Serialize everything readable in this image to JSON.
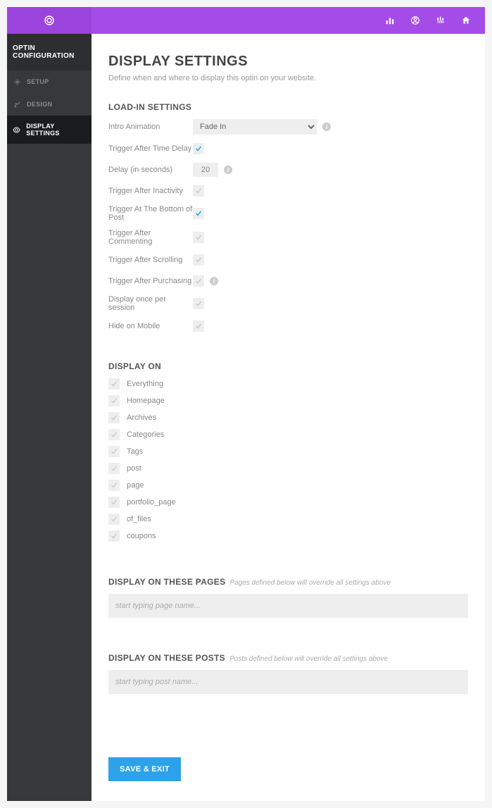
{
  "topbar": {
    "icons": [
      "stats-icon",
      "user-icon",
      "config-icon",
      "home-icon"
    ]
  },
  "sidebar": {
    "header": "OPTIN CONFIGURATION",
    "items": [
      {
        "label": "SETUP",
        "icon": "gear-icon",
        "active": false
      },
      {
        "label": "DESIGN",
        "icon": "design-icon",
        "active": false
      },
      {
        "label": "DISPLAY SETTINGS",
        "icon": "display-icon",
        "active": true
      }
    ]
  },
  "page": {
    "title": "DISPLAY SETTINGS",
    "subtitle": "Define when and where to display this optin on your website."
  },
  "loadin": {
    "section_title": "LOAD-IN SETTINGS",
    "intro_animation_label": "Intro Animation",
    "intro_animation_value": "Fade In",
    "trigger_time_label": "Trigger After Time Delay",
    "delay_label": "Delay (in seconds)",
    "delay_value": "20",
    "trigger_inactivity_label": "Trigger After Inactivity",
    "trigger_bottom_label": "Trigger At The Bottom of Post",
    "trigger_commenting_label": "Trigger After Commenting",
    "trigger_scrolling_label": "Trigger After Scrolling",
    "trigger_purchasing_label": "Trigger After Purchasing",
    "display_once_label": "Display once per session",
    "hide_mobile_label": "Hide on Mobile"
  },
  "displayon": {
    "section_title": "DISPLAY ON",
    "items": [
      {
        "label": "Everything"
      },
      {
        "label": "Homepage"
      },
      {
        "label": "Archives"
      },
      {
        "label": "Categories"
      },
      {
        "label": "Tags"
      },
      {
        "label": "post"
      },
      {
        "label": "page"
      },
      {
        "label": "portfolio_page"
      },
      {
        "label": "of_files"
      },
      {
        "label": "coupons"
      }
    ]
  },
  "pages": {
    "title": "DISPLAY ON THESE PAGES",
    "hint": "Pages defined below will override all settings above",
    "placeholder": "start typing page name..."
  },
  "posts": {
    "title": "DISPLAY ON THESE POSTS",
    "hint": "Posts defined below will override all settings above",
    "placeholder": "start typing post name..."
  },
  "save_label": "SAVE & EXIT"
}
